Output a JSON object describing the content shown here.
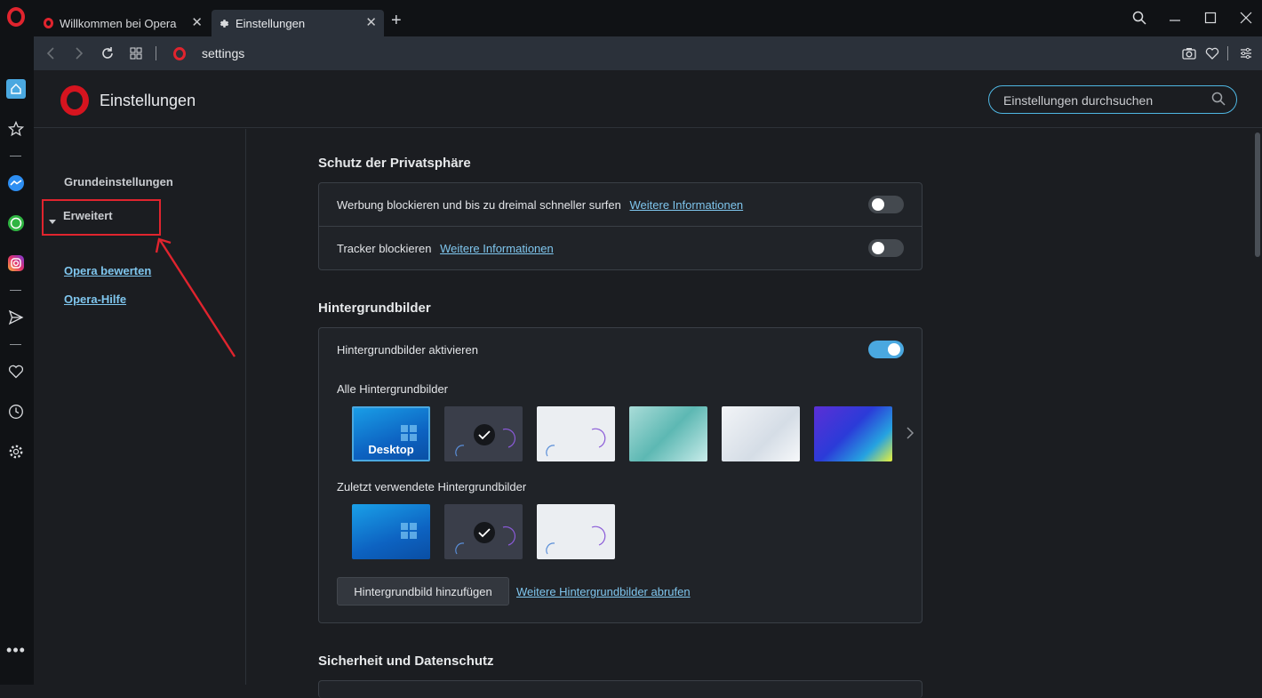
{
  "tabs": [
    {
      "label": "Willkommen bei Opera",
      "icon": "opera-icon",
      "active": false
    },
    {
      "label": "Einstellungen",
      "icon": "gear-icon",
      "active": true
    }
  ],
  "address": {
    "url": "settings"
  },
  "header": {
    "title": "Einstellungen",
    "search_placeholder": "Einstellungen durchsuchen"
  },
  "leftnav": {
    "basic": "Grundeinstellungen",
    "advanced": "Erweitert",
    "rate": "Opera bewerten",
    "help": "Opera-Hilfe"
  },
  "privacy": {
    "title": "Schutz der Privatsphäre",
    "rows": [
      {
        "label": "Werbung blockieren und bis zu dreimal schneller surfen",
        "link": "Weitere Informationen",
        "enabled": false
      },
      {
        "label": "Tracker blockieren",
        "link": "Weitere Informationen",
        "enabled": false
      }
    ]
  },
  "wallpapers": {
    "title": "Hintergrundbilder",
    "enable_label": "Hintergrundbilder aktivieren",
    "enabled": true,
    "all_label": "Alle Hintergrundbilder",
    "desktop_label": "Desktop",
    "recent_label": "Zuletzt verwendete Hintergrundbilder",
    "add_button": "Hintergrundbild hinzufügen",
    "more_link": "Weitere Hintergrundbilder abrufen"
  },
  "security": {
    "title": "Sicherheit und Datenschutz"
  },
  "colors": {
    "accent": "#4aa8e0",
    "link": "#7fc6ee",
    "opera_red": "#e0242e",
    "annotation_red": "#e0242e"
  }
}
